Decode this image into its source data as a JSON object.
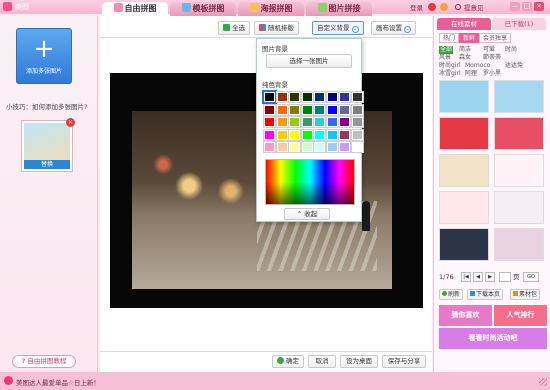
{
  "app": {
    "title": "美图"
  },
  "tabs": [
    {
      "label": "自由拼图",
      "icon": "free-collage-icon",
      "color": "#f58bb4",
      "active": true
    },
    {
      "label": "模板拼图",
      "icon": "template-collage-icon",
      "color": "#6ab6ef",
      "active": false
    },
    {
      "label": "海报拼图",
      "icon": "poster-collage-icon",
      "color": "#f7c15a",
      "active": false
    },
    {
      "label": "图片拼接",
      "icon": "image-stitch-icon",
      "color": "#8fd06a",
      "active": false
    }
  ],
  "titlebar": {
    "login": "登录",
    "feedback": "提意见",
    "minimize": "—",
    "maximize": "□",
    "close": "×"
  },
  "left": {
    "add_label": "添加多张图片",
    "add_symbol": "+",
    "tip": "小技巧：如何添加多张图片?",
    "thumb_swap": "替换",
    "thumb_delete": "×",
    "tutorial": "自由拼图教程",
    "tutorial_prefix": "?"
  },
  "toolbar": {
    "select_all": "全选",
    "random": "随机排版",
    "custom_bg": "自定义背景",
    "custom_bg_arrow": "⌄",
    "canvas_settings": "画布设置",
    "canvas_arrow": "⌄"
  },
  "dropdown": {
    "image_bg_header": "图片背景",
    "choose_image": "选择一张图片",
    "solid_header": "纯色背景",
    "collapse": "收起",
    "collapse_symbol": "⌃",
    "swatch_colors": [
      "#000000",
      "#993300",
      "#333300",
      "#003300",
      "#003366",
      "#000080",
      "#333399",
      "#333333",
      "#800000",
      "#ff6600",
      "#808000",
      "#008000",
      "#008080",
      "#0000ff",
      "#666699",
      "#808080",
      "#ff0000",
      "#ff9900",
      "#99cc00",
      "#339966",
      "#33cccc",
      "#3366ff",
      "#800080",
      "#969696",
      "#ff00ff",
      "#ffcc00",
      "#ffff00",
      "#00ff00",
      "#00ffff",
      "#00ccff",
      "#993366",
      "#c0c0c0",
      "#ff99cc",
      "#ffcc99",
      "#ffff99",
      "#ccffcc",
      "#ccffff",
      "#99ccff",
      "#cc99ff",
      "#ffffff"
    ],
    "selected_swatch": 0
  },
  "bottom": {
    "ok": "确定",
    "cancel": "取消",
    "set_desktop": "设为桌面",
    "save_share": "保存与分享"
  },
  "right": {
    "tab_online": "在线素材",
    "tab_downloaded": "已下载(1)",
    "sub_hot": "热门",
    "sub_new": "新鲜",
    "sub_member": "会员独享",
    "categories": [
      {
        "label": "全部",
        "active": true
      },
      {
        "label": "简洁",
        "active": false
      },
      {
        "label": "可爱",
        "active": false
      },
      {
        "label": "时尚",
        "active": false
      },
      {
        "label": "风景",
        "active": false
      },
      {
        "label": "森女",
        "active": false
      },
      {
        "label": "節荼荼",
        "active": false
      },
      {
        "label": "时尚girl",
        "active": false
      },
      {
        "label": "Momoco",
        "active": false
      },
      {
        "label": "达达兔",
        "active": false
      },
      {
        "label": "冰雪girl",
        "active": false
      },
      {
        "label": "阿狸",
        "active": false
      },
      {
        "label": "罗小黑",
        "active": false
      }
    ],
    "thumb_colors": [
      "#9ad4ef",
      "#a7d9f2",
      "#e63946",
      "#e84f66",
      "#f3e3c6",
      "#fff3f7",
      "#ffe7ea",
      "#f6eef2",
      "#2c3647",
      "#e9d3e3"
    ],
    "pager_text": "1/76",
    "pager_first": "|◀",
    "pager_prev": "◀",
    "pager_next": "▶",
    "pager_page_unit": "页",
    "pager_go": "GO",
    "refresh": "刷新",
    "download_page": "下载本页",
    "material_pack": "素材包",
    "promo_1": "猜你喜欢",
    "promo_2": "人气排行",
    "promo_3": "看看时尚活动吧",
    "promo_colors": [
      "#e879c7",
      "#f56e8c",
      "#d67de6"
    ]
  },
  "status": {
    "text": "美图达人最爱单品☆日上新！"
  }
}
